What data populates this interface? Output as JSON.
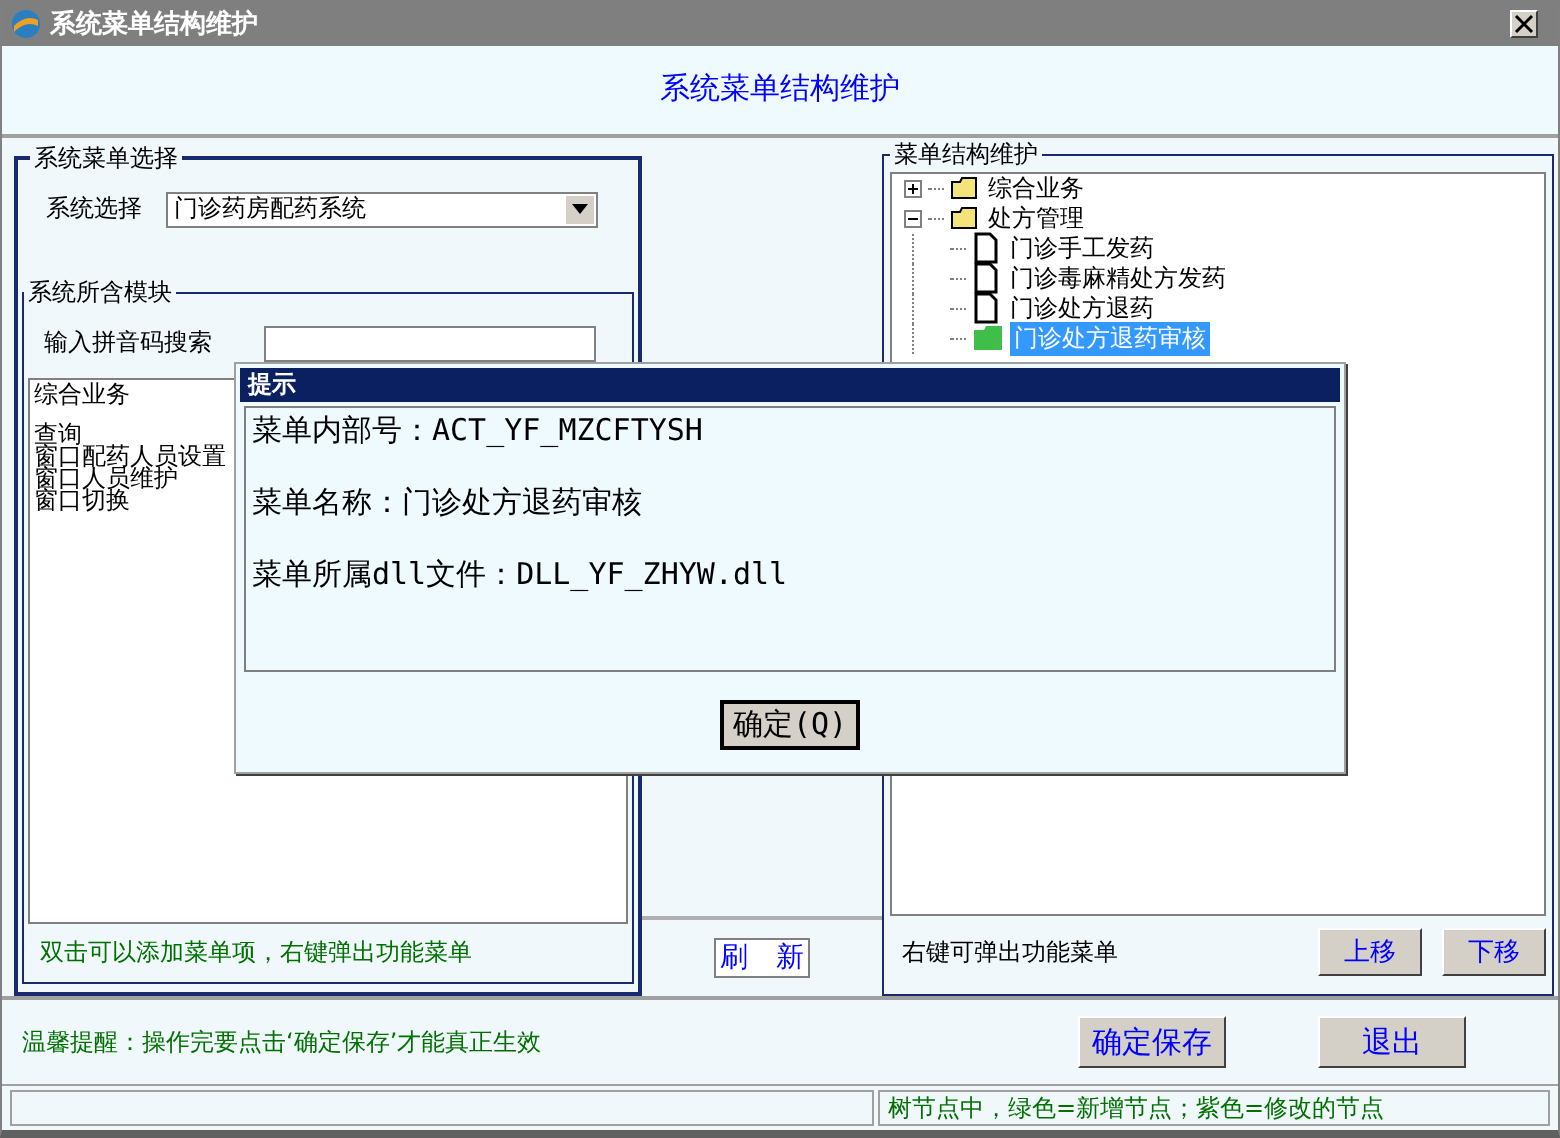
{
  "window": {
    "title": "系统菜单结构维护"
  },
  "header": {
    "title": "系统菜单结构维护"
  },
  "left_panel": {
    "legend": "系统菜单选择",
    "system_label": "系统选择",
    "system_value": "门诊药房配药系统",
    "modules": {
      "legend": "系统所含模块",
      "search_label": "输入拼音码搜索",
      "items": [
        "综合业务",
        "查询",
        "窗口配药人员设置",
        "窗口人员维护",
        "窗口切换"
      ],
      "hint": "双击可以添加菜单项，右键弹出功能菜单"
    }
  },
  "refresh_button": "刷　新",
  "right_panel": {
    "legend": "菜单结构维护",
    "tree": [
      {
        "label": "综合业务",
        "kind": "folder",
        "expanded": false,
        "selected": false
      },
      {
        "label": "处方管理",
        "kind": "folder",
        "expanded": true,
        "selected": false,
        "children": [
          {
            "label": "门诊手工发药",
            "kind": "file",
            "selected": false
          },
          {
            "label": "门诊毒麻精处方发药",
            "kind": "file",
            "selected": false
          },
          {
            "label": "门诊处方退药",
            "kind": "file",
            "selected": false
          },
          {
            "label": "门诊处方退药审核",
            "kind": "new",
            "selected": true
          }
        ]
      }
    ],
    "hint": "右键可弹出功能菜单",
    "buttons": [
      "上移",
      "下移"
    ]
  },
  "footer": {
    "reminder": "温馨提醒：操作完要点击‘确定保存’才能真正生效",
    "buttons": [
      "确定保存",
      "退出"
    ]
  },
  "status_bar": {
    "section_2": "树节点中，绿色=新增节点；紫色=修改的节点"
  },
  "dialog": {
    "title": "提示",
    "lines": [
      "菜单内部号：ACT_YF_MZCFTYSH",
      "菜单名称：门诊处方退药审核",
      "菜单所属dll文件：DLL_YF_ZHYW.dll"
    ],
    "button": "确定(Q)"
  }
}
